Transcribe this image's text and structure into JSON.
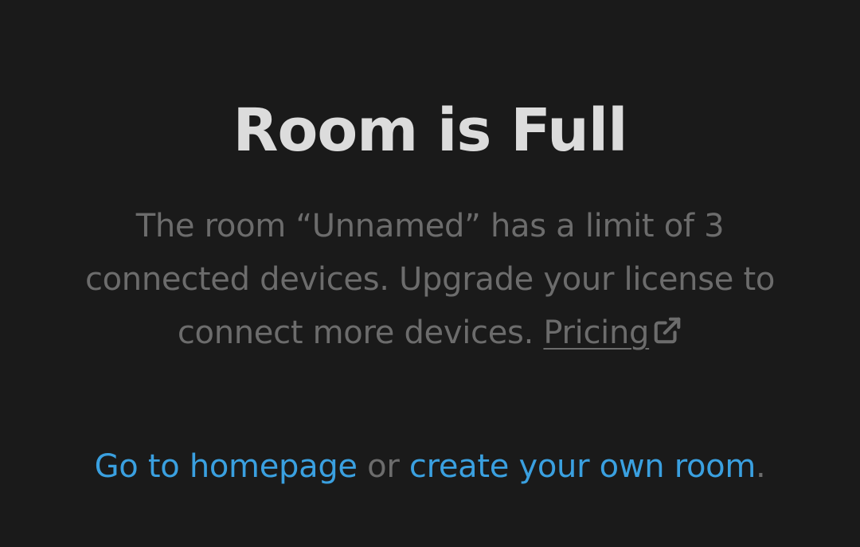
{
  "title": "Room is Full",
  "message": {
    "line1": "The room “Unnamed” has a limit of 3",
    "line2": "connected devices. Upgrade your license to",
    "line3": "connect more devices.",
    "pricing_link": "Pricing",
    "pricing_icon": "external-link-icon"
  },
  "footer": {
    "homepage_link": "Go to homepage",
    "connector": "or",
    "create_room_link": "create your own room",
    "end_punctuation": "."
  },
  "colors": {
    "background": "#1a1a1a",
    "title": "#dcdcdc",
    "body_text": "#6c6c6c",
    "link": "#3aa0e0"
  }
}
